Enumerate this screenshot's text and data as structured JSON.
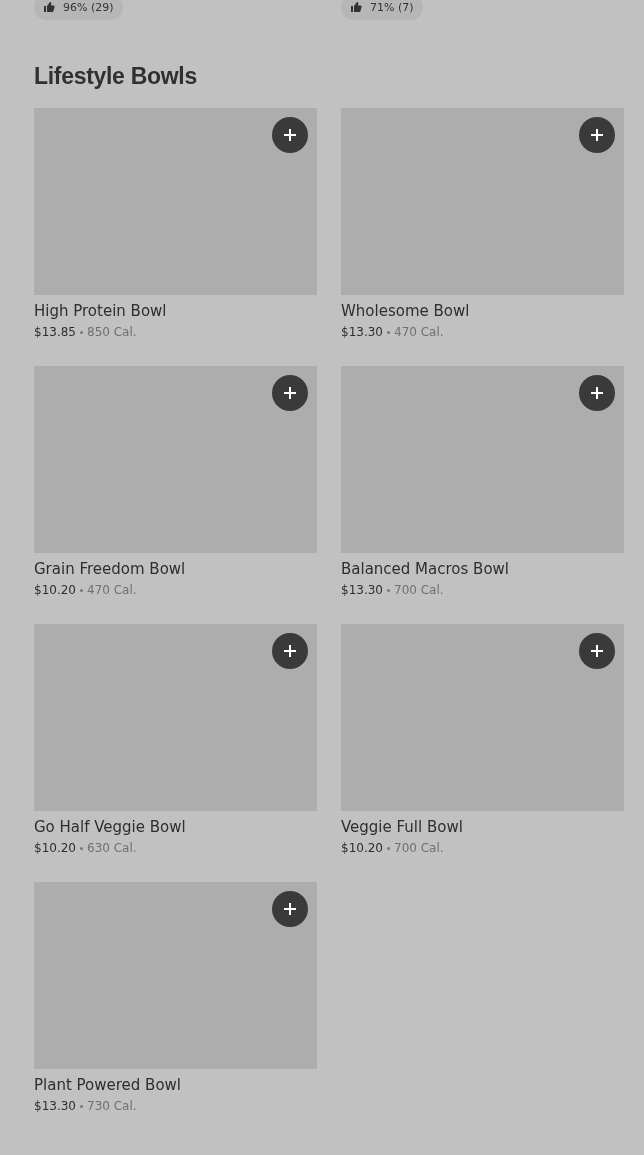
{
  "ratings": [
    {
      "text": "96% (29)"
    },
    {
      "text": "71% (7)"
    }
  ],
  "section": {
    "title": "Lifestyle Bowls",
    "items": [
      {
        "name": "High Protein Bowl",
        "price": "$13.85",
        "calories": "850 Cal."
      },
      {
        "name": "Wholesome Bowl",
        "price": "$13.30",
        "calories": "470 Cal."
      },
      {
        "name": "Grain Freedom Bowl",
        "price": "$10.20",
        "calories": "470 Cal."
      },
      {
        "name": "Balanced Macros Bowl",
        "price": "$13.30",
        "calories": "700 Cal."
      },
      {
        "name": "Go Half Veggie Bowl",
        "price": "$10.20",
        "calories": "630 Cal."
      },
      {
        "name": "Veggie Full Bowl",
        "price": "$10.20",
        "calories": "700 Cal."
      },
      {
        "name": "Plant Powered Bowl",
        "price": "$13.30",
        "calories": "730 Cal."
      }
    ]
  }
}
